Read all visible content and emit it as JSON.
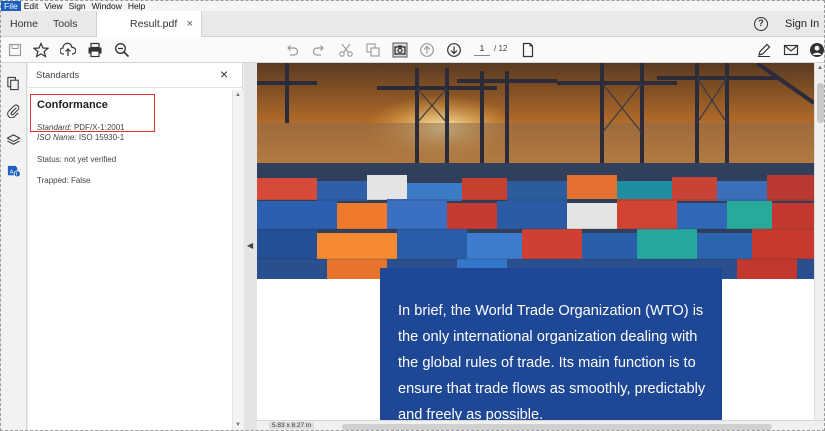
{
  "menubar": {
    "items": [
      "File",
      "Edit",
      "View",
      "Sign",
      "Window",
      "Help"
    ]
  },
  "tabs": {
    "home": "Home",
    "tools": "Tools",
    "document": "Result.pdf",
    "close": "×",
    "signin": "Sign In",
    "help_glyph": "?"
  },
  "toolbar": {
    "current_page": "1",
    "page_total": "/ 12"
  },
  "panel": {
    "title": "Standards",
    "close": "×",
    "conformance_heading": "Conformance",
    "standard_label": "Standard:",
    "standard_value": "PDF/X-1:2001",
    "iso_label": "ISO Name:",
    "iso_value": "ISO 15930-1",
    "status": "Status: not yet verified",
    "trapped": "Trapped: False"
  },
  "document": {
    "body_text": "In brief, the World Trade Organization (WTO) is the only international organization dealing with the global rules of trade. Its main function is to ensure that trade flows as smoothly, predictably and freely as possible."
  },
  "statusbar": {
    "page_size": "5.83 x 8.27 in"
  },
  "colors": {
    "accent": "#1c5fbf",
    "doc_blue": "#1e4796",
    "highlight_red": "#e5332a"
  }
}
